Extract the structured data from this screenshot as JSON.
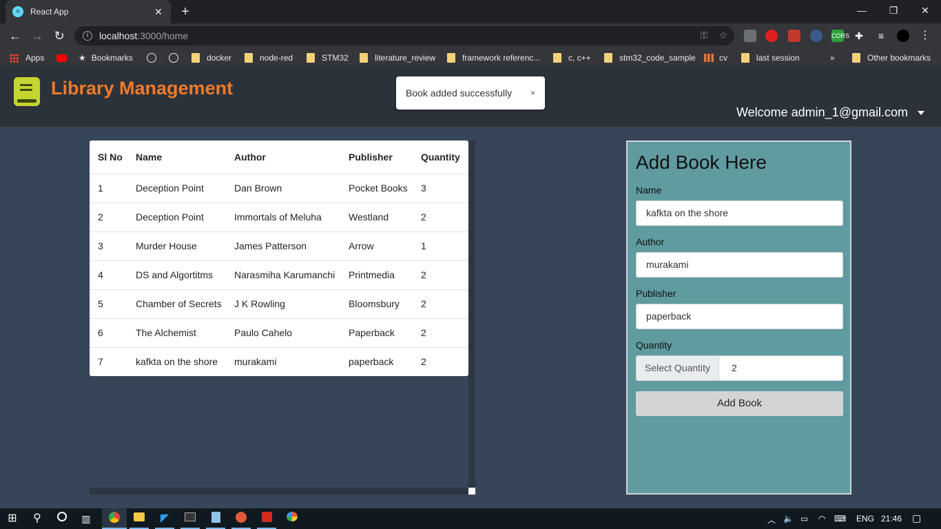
{
  "browser": {
    "tab_title": "React App",
    "url_host": "localhost",
    "url_path": ":3000/home",
    "bookmarks": [
      "Apps",
      "Bookmarks",
      "docker",
      "node-red",
      "STM32",
      "literature_review",
      "framework referenc...",
      "c, c++",
      "stm32_code_sample",
      "cv",
      "last session",
      "»",
      "Other bookmarks"
    ]
  },
  "app": {
    "brand": "Library Management",
    "toast": "Book added successfully",
    "toast_close": "×",
    "welcome": "Welcome admin_1@gmail.com"
  },
  "table": {
    "headers": [
      "Sl No",
      "Name",
      "Author",
      "Publisher",
      "Quantity"
    ],
    "rows": [
      [
        "1",
        "Deception Point",
        "Dan Brown",
        "Pocket Books",
        "3"
      ],
      [
        "2",
        "Deception Point",
        "Immortals of Meluha",
        "Westland",
        "2"
      ],
      [
        "3",
        "Murder House",
        "James Patterson",
        "Arrow",
        "1"
      ],
      [
        "4",
        "DS and Algortitms",
        "Narasmiha Karumanchi",
        "Printmedia",
        "2"
      ],
      [
        "5",
        "Chamber of Secrets",
        "J K Rowling",
        "Bloomsbury",
        "2"
      ],
      [
        "6",
        "The Alchemist",
        "Paulo Cahelo",
        "Paperback",
        "2"
      ],
      [
        "7",
        "kafkta on the shore",
        "murakami",
        "paperback",
        "2"
      ]
    ]
  },
  "form": {
    "title": "Add Book Here",
    "name_label": "Name",
    "name_value": "kafkta on the shore",
    "author_label": "Author",
    "author_value": "murakami",
    "publisher_label": "Publisher",
    "publisher_value": "paperback",
    "quantity_label": "Quantity",
    "quantity_addon": "Select Quantity",
    "quantity_value": "2",
    "submit_label": "Add Book"
  },
  "taskbar": {
    "language": "ENG",
    "time": "21:46"
  }
}
